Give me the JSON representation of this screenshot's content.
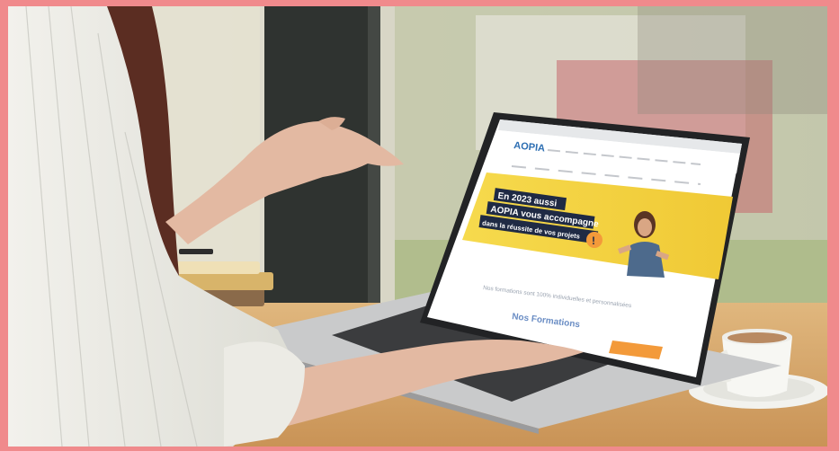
{
  "photo": {
    "border_color": "#f08a8c",
    "accent_yellow": "#f6d84a",
    "accent_blue": "#2e6fb3",
    "accent_orange": "#f39a3a"
  },
  "website": {
    "logo": "AOPIA",
    "hero_lines": [
      "En 2023 aussi",
      "AOPIA vous accompagne",
      "dans la réussite de vos projets"
    ],
    "tagline": "Nos formations sont 100% individuelles et personnalisées",
    "section_title": "Nos Formations"
  }
}
